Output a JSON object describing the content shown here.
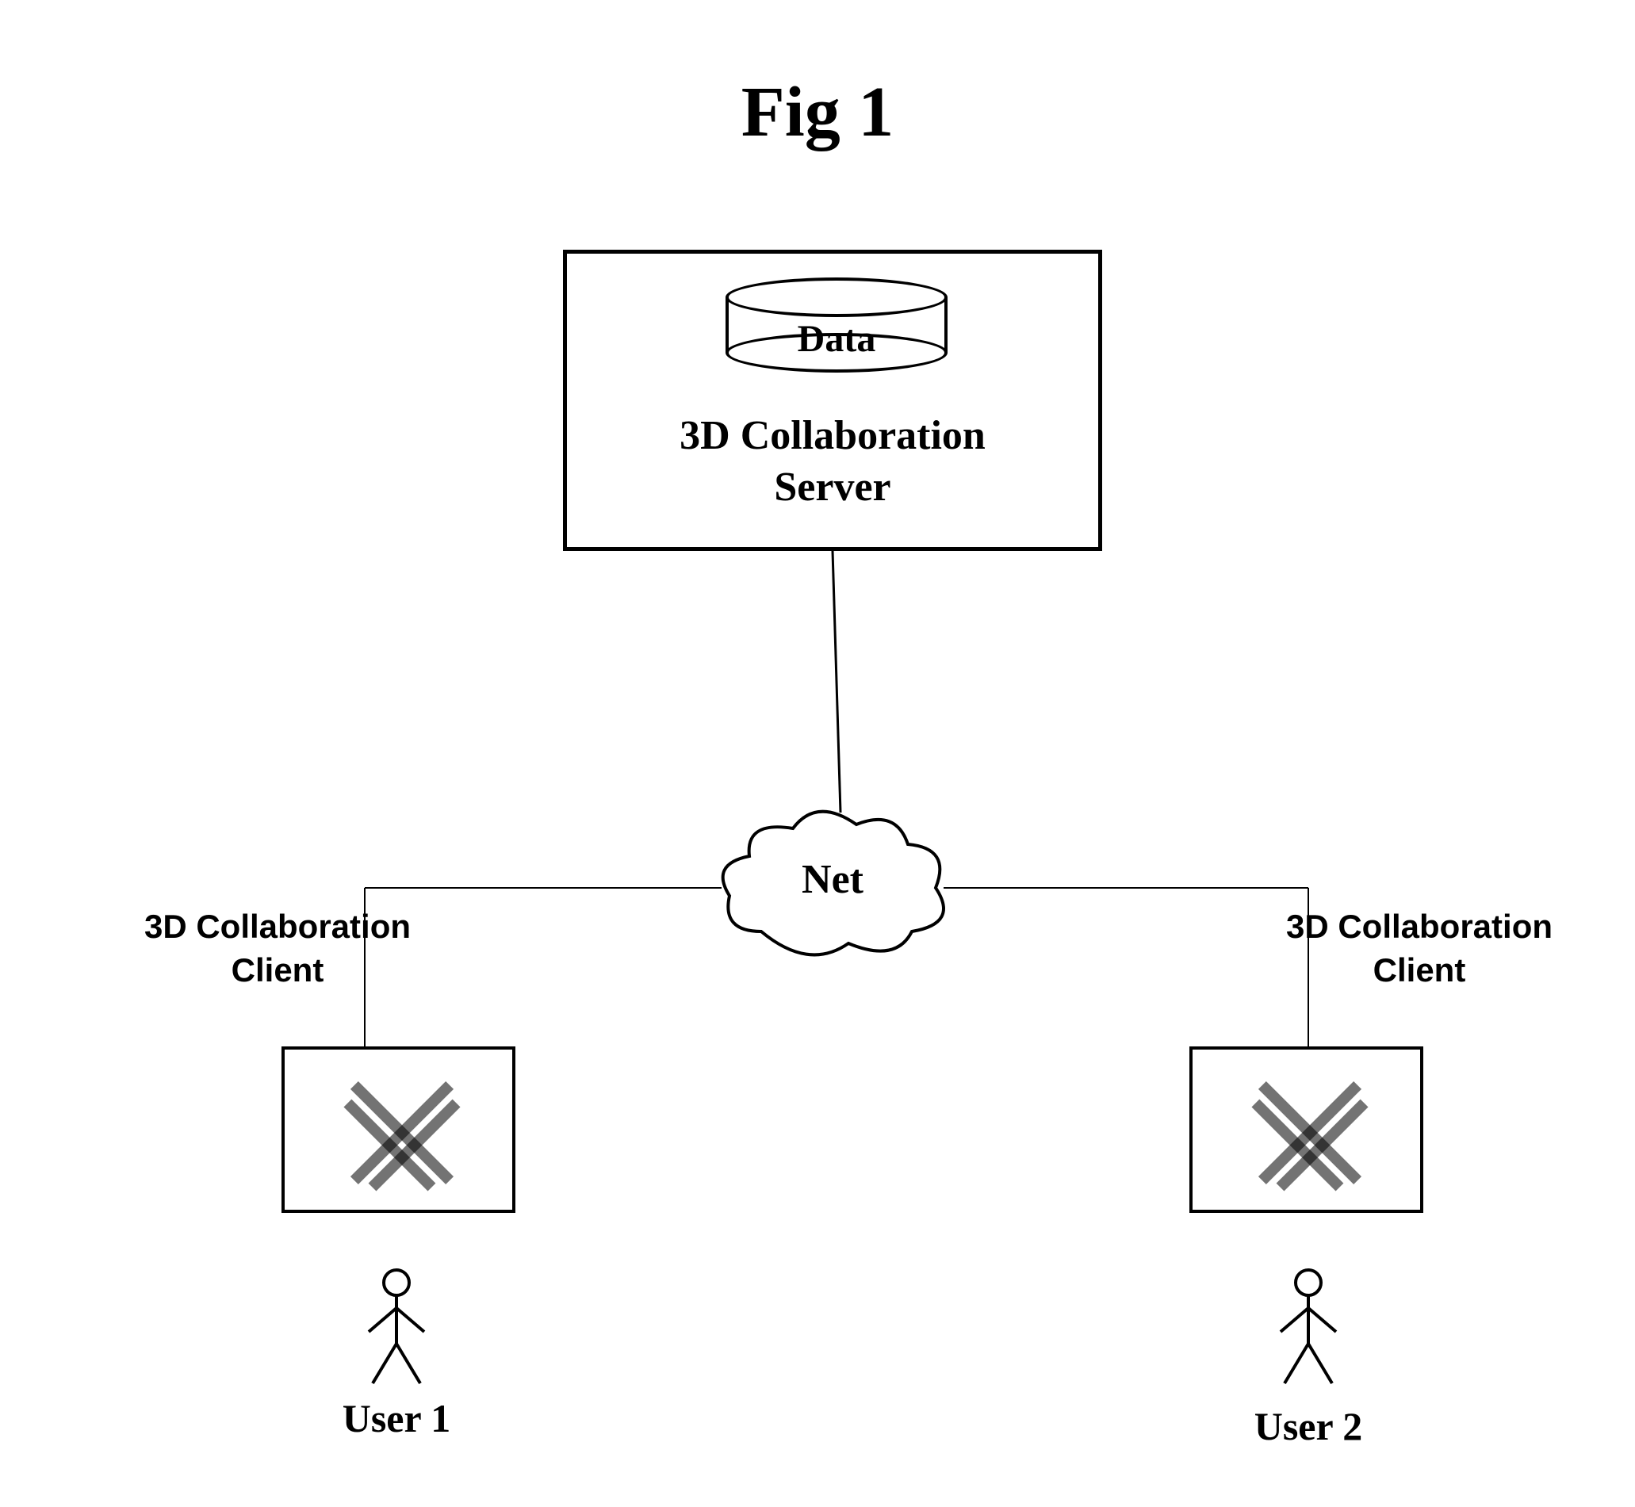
{
  "figure": {
    "title": "Fig 1"
  },
  "server": {
    "data_label": "Data",
    "title_line1": "3D Collaboration",
    "title_line2": "Server"
  },
  "network": {
    "label": "Net"
  },
  "client_left": {
    "title_line1": "3D Collaboration",
    "title_line2": "Client",
    "user_label": "User 1"
  },
  "client_right": {
    "title_line1": "3D Collaboration",
    "title_line2": "Client",
    "user_label": "User 2"
  }
}
